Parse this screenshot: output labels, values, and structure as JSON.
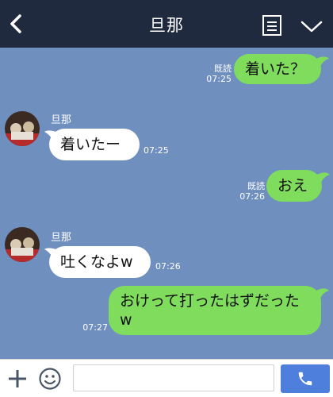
{
  "header": {
    "title": "旦那",
    "back_icon": "chevron-left-icon",
    "menu_icon": "note-list-icon",
    "expand_icon": "chevron-down-icon",
    "background": "#1f2a3e"
  },
  "chat_background": "#6f8fbf",
  "messages": [
    {
      "direction": "out",
      "text": "着いた？",
      "read": "既読",
      "time": "07:25"
    },
    {
      "direction": "in",
      "sender": "旦那",
      "text": "着いたー",
      "time": "07:25"
    },
    {
      "direction": "out",
      "text": "おえ",
      "read": "既読",
      "time": "07:26"
    },
    {
      "direction": "in",
      "sender": "旦那",
      "text": "吐くなよw",
      "time": "07:26"
    },
    {
      "direction": "out",
      "text": "おけって打ったはずだったw",
      "line1": "おけって打ったはずだった",
      "line2": "w",
      "time": "07:27"
    }
  ],
  "colors": {
    "outgoing_bubble": "#80dc5d",
    "incoming_bubble": "#ffffff",
    "send_button": "#4f7fdc"
  },
  "composer": {
    "placeholder": "",
    "value": "",
    "add_icon": "plus-icon",
    "emoji_icon": "smiley-icon",
    "call_icon": "phone-icon"
  }
}
